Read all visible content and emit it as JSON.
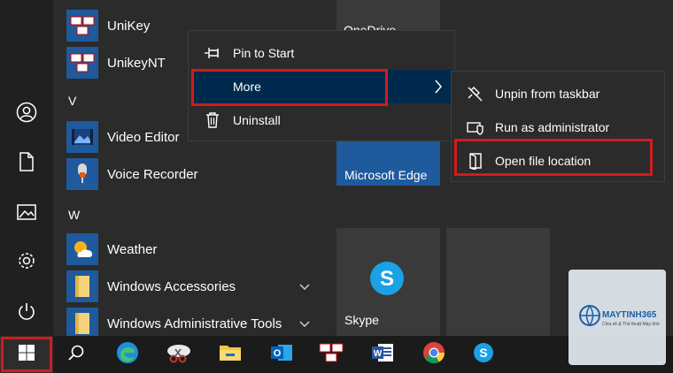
{
  "applist": {
    "sections": [
      {
        "letter": "V"
      },
      {
        "letter": "W"
      }
    ],
    "apps": [
      {
        "label": "UniKey"
      },
      {
        "label": "UnikeyNT"
      },
      {
        "label": "Video Editor"
      },
      {
        "label": "Voice Recorder"
      },
      {
        "label": "Weather"
      },
      {
        "label": "Windows Accessories"
      },
      {
        "label": "Windows Administrative Tools"
      }
    ]
  },
  "tiles": {
    "onedrive": "OneDrive",
    "edge": "Microsoft Edge",
    "skype": "Skype"
  },
  "context_menu": {
    "items": [
      {
        "label": "Pin to Start",
        "icon": "pin-icon"
      },
      {
        "label": "More",
        "icon": ""
      },
      {
        "label": "Uninstall",
        "icon": "trash-icon"
      }
    ],
    "submenu_arrow": ">"
  },
  "submenu": {
    "items": [
      {
        "label": "Unpin from taskbar",
        "icon": "unpin-icon"
      },
      {
        "label": "Run as administrator",
        "icon": "shield-icon"
      },
      {
        "label": "Open file location",
        "icon": "folder-location-icon"
      }
    ]
  },
  "taskbar": {
    "items": [
      "start-icon",
      "search-icon",
      "edge-icon",
      "snipping-tool-icon",
      "file-explorer-icon",
      "outlook-icon",
      "unikey-icon",
      "word-icon",
      "chrome-icon",
      "skype-icon"
    ]
  },
  "watermark": {
    "brand": "MAYTINH365",
    "tagline": "Chia sẻ & Thủ thuật Máy tính"
  },
  "colors": {
    "accent_highlight": "#002a4d",
    "annotation_red": "#d01c1c",
    "tile_blue": "#1e5a9c"
  }
}
